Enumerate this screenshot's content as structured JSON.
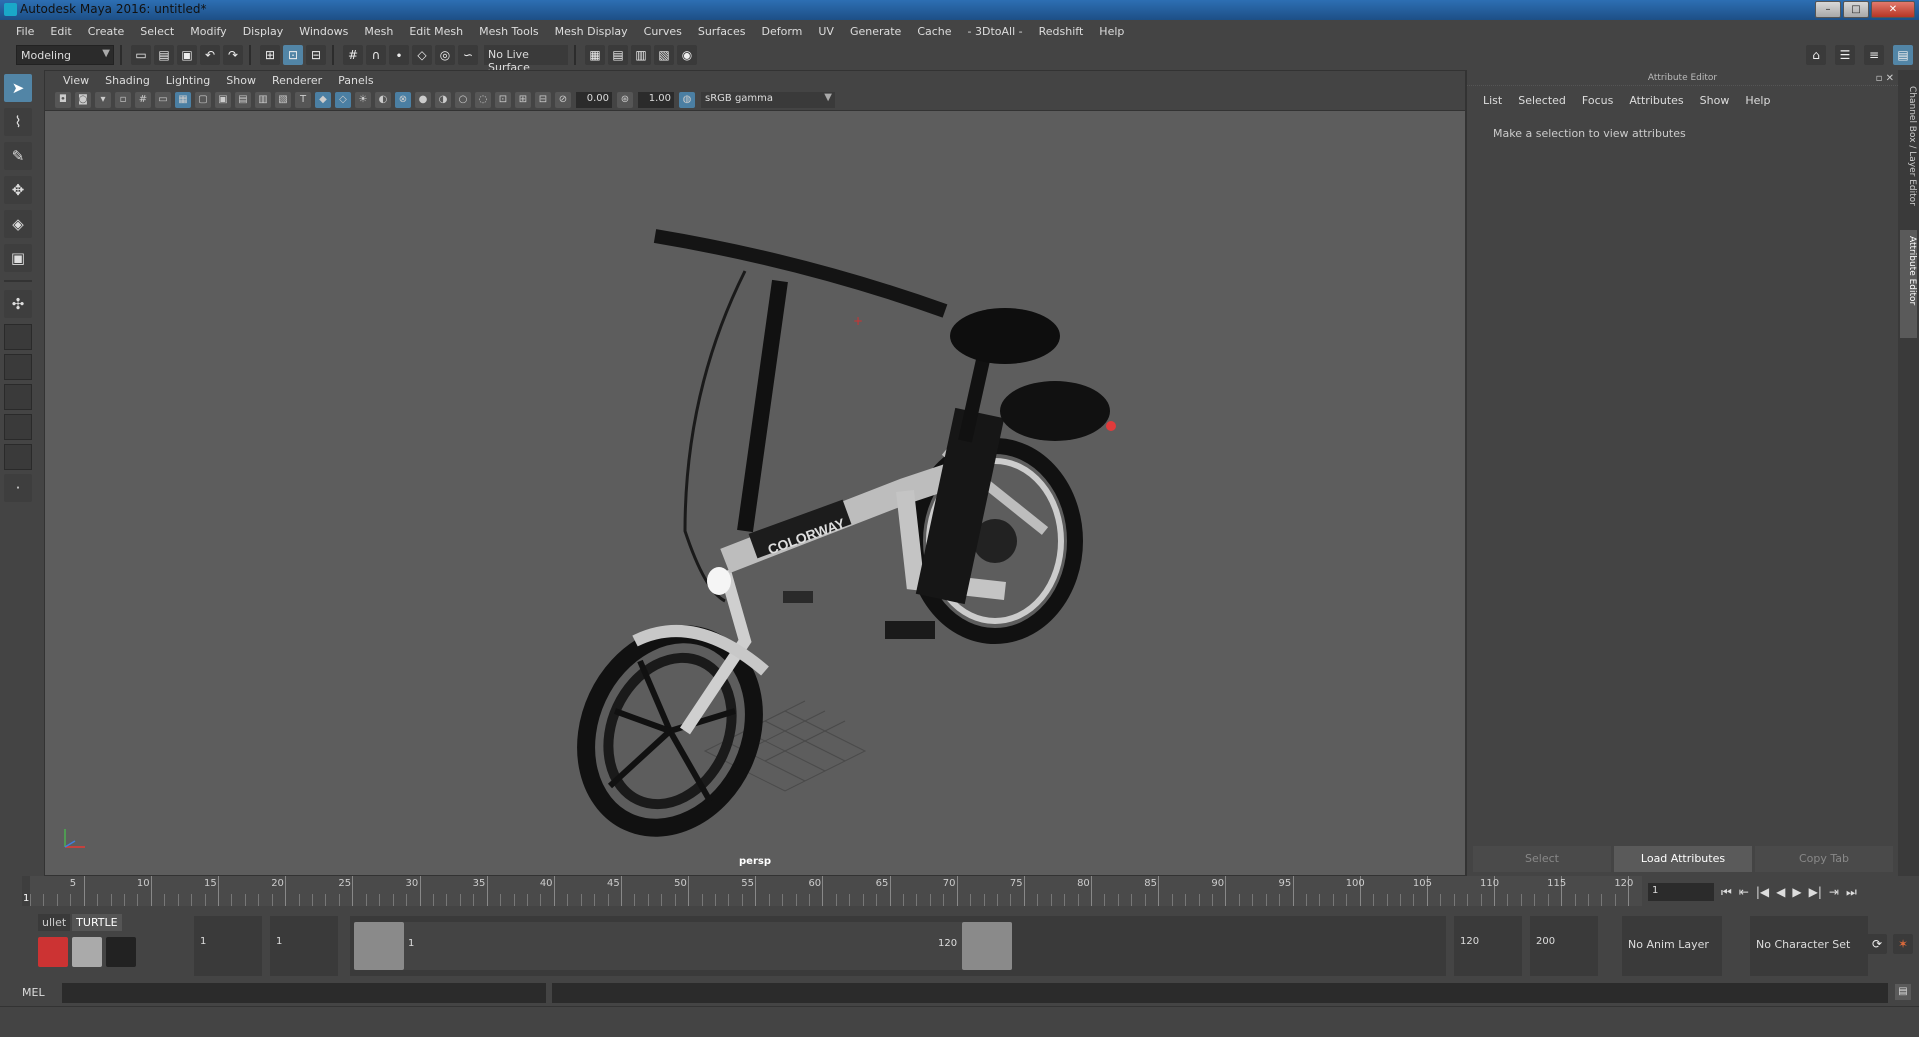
{
  "window": {
    "title": "Autodesk Maya 2016: untitled*",
    "minimize": "–",
    "maximize": "□",
    "close": "✕"
  },
  "menubar": [
    "File",
    "Edit",
    "Create",
    "Select",
    "Modify",
    "Display",
    "Windows",
    "Mesh",
    "Edit Mesh",
    "Mesh Tools",
    "Mesh Display",
    "Curves",
    "Surfaces",
    "Deform",
    "UV",
    "Generate",
    "Cache",
    "- 3DtoAll -",
    "Redshift",
    "Help"
  ],
  "statusline": {
    "mode": "Modeling",
    "live_surface": "No Live Surface"
  },
  "viewport": {
    "menu": [
      "View",
      "Shading",
      "Lighting",
      "Show",
      "Renderer",
      "Panels"
    ],
    "exposure": "0.00",
    "gamma": "1.00",
    "colorspace": "sRGB gamma",
    "camera": "persp",
    "bike_brand": "COLORWAY"
  },
  "attribute_editor": {
    "header": "Attribute Editor",
    "menu": [
      "List",
      "Selected",
      "Focus",
      "Attributes",
      "Show",
      "Help"
    ],
    "message": "Make a selection to view attributes",
    "buttons": {
      "select": "Select",
      "load": "Load Attributes",
      "copy": "Copy Tab"
    },
    "side_tab_1": "Channel Box / Layer Editor",
    "side_tab_2": "Attribute Editor"
  },
  "timeline": {
    "ticks": [
      "5",
      "10",
      "15",
      "20",
      "25",
      "30",
      "35",
      "40",
      "45",
      "50",
      "55",
      "60",
      "65",
      "70",
      "75",
      "80",
      "85",
      "90",
      "95",
      "100",
      "105",
      "110",
      "115",
      "120"
    ],
    "current_frame_label": "1",
    "current_frame_field": "1",
    "playback": [
      "⏮",
      "⇤",
      "|◀",
      "◀",
      "▶",
      "▶|",
      "⇥",
      "⏭"
    ]
  },
  "range": {
    "shelf_tabs": [
      "ullet",
      "TURTLE"
    ],
    "start": "1",
    "playback_start": "1",
    "range_start_label": "1",
    "range_end_label": "120",
    "playback_end": "120",
    "end": "200",
    "anim_layer": "No Anim Layer",
    "character_set": "No Character Set"
  },
  "cmdline": {
    "label": "MEL"
  }
}
